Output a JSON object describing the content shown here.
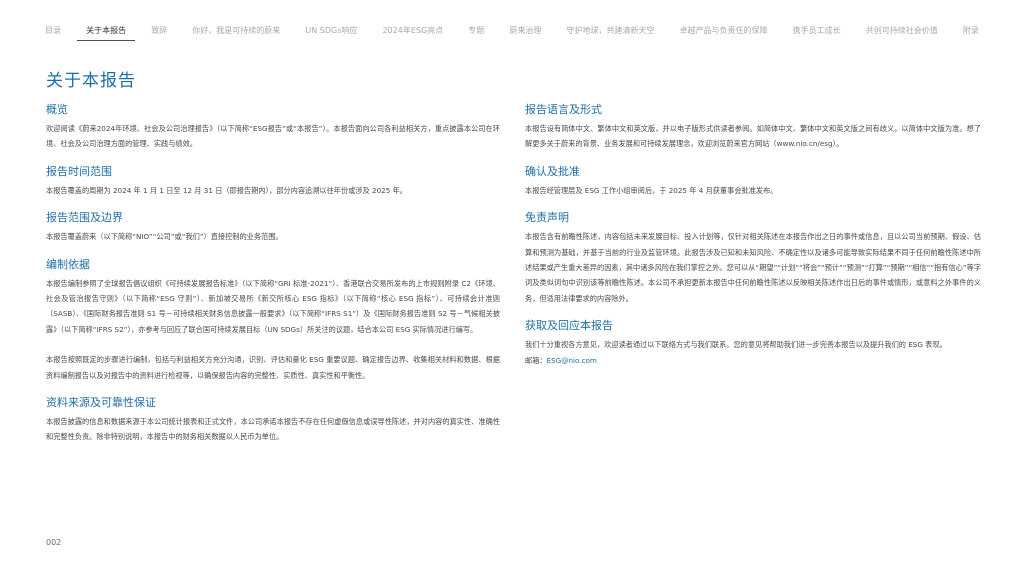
{
  "nav": {
    "items": [
      {
        "label": "目录"
      },
      {
        "label": "关于本报告"
      },
      {
        "label": "致辞"
      },
      {
        "label": "你好，我是可持续的蔚来"
      },
      {
        "label": "UN SDGs响应"
      },
      {
        "label": "2024年ESG亮点"
      },
      {
        "label": "专题"
      },
      {
        "label": "蔚来治理"
      },
      {
        "label": "守护地球，共建清新天空"
      },
      {
        "label": "卓越产品与负责任的保障"
      },
      {
        "label": "携手员工成长"
      },
      {
        "label": "共创可持续社会价值"
      },
      {
        "label": "附录"
      }
    ]
  },
  "page": {
    "title": "关于本报告",
    "number": "002"
  },
  "left": {
    "overview": {
      "heading": "概览",
      "text": "欢迎阅读《蔚来2024年环境、社会及公司治理报告》（以下简称“ESG报告”或“本报告”）。本报告面向公司各利益相关方，重点披露本公司在环境、社会及公司治理方面的管理、实践与绩效。"
    },
    "period": {
      "heading": "报告时间范围",
      "text": "本报告覆盖的周期为 2024 年 1 月 1 日至 12 月 31 日（即报告期内），部分内容追溯以往年份或涉及 2025 年。"
    },
    "scope": {
      "heading": "报告范围及边界",
      "text": "本报告覆盖蔚来（以下简称“NIO”“公司”或“我们”）直接控制的业务范围。"
    },
    "basis": {
      "heading": "编制依据",
      "text1": "本报告编制参照了全球报告倡议组织《可持续发展报告标准》（以下简称“GRI 标准-2021”）、香港联合交易所发布的上市规则附录 C2《环境、社会及管治报告守则》（以下简称“ESG 守则”）、新加坡交易所《新交所核心 ESG 指标》（以下简称“核心 ESG 指标”）、可持续会计准则（SASB）、《国际财务报告准则 S1 号－可持续相关财务信息披露一般要求》（以下简称“IFRS S1”）及《国际财务报告准则 S2 号－气候相关披露》（以下简称“IFRS S2”），亦参考与回应了联合国可持续发展目标（UN SDGs）所关注的议题，结合本公司 ESG 实际情况进行编写。",
      "text2": "本报告按照既定的步骤进行编制，包括与利益相关方充分沟通，识别、评估和量化 ESG 重要议题、确定报告边界、收集相关材料和数据、根据资料编制报告以及对报告中的资料进行检视等，以确保报告内容的完整性、实质性、真实性和平衡性。"
    },
    "data_source": {
      "heading": "资料来源及可靠性保证",
      "text": "本报告披露的信息和数据来源于本公司统计报表和正式文件，本公司承诺本报告不存在任何虚假信息或误导性陈述，并对内容的真实性、准确性和完整性负责。除非特别说明，本报告中的财务相关数据以人民币为单位。"
    }
  },
  "right": {
    "language": {
      "heading": "报告语言及形式",
      "text": "本报告设有简体中文、繁体中文和英文版，并以电子版形式供读者参阅。如简体中文、繁体中文和英文版之间有歧义，以简体中文版为准。想了解更多关于蔚来的背景、业务发展和可持续发展理念，欢迎浏览蔚来官方网站（www.nio.cn/esg）。"
    },
    "approval": {
      "heading": "确认及批准",
      "text": "本报告经管理层及 ESG 工作小组审阅后，于 2025 年 4 月获董事会批准发布。"
    },
    "disclaimer": {
      "heading": "免责声明",
      "text": "本报告含有前瞻性陈述，内容包括未来发展目标、投入计划等，仅针对相关陈述在本报告作出之日的事件或信息，且以公司当前预期、假设、估算和预测为基础，并基于当前的行业及监管环境。此报告涉及已知和未知风险、不确定性以及诸多可能导致实际结果不同于任何前瞻性陈述中所述结果或产生重大差异的因素，其中诸多风险在我们掌控之外。您可以从“期望”“计划”“将会”“预计”“预测”“打算”“预期”“相信”“抱有信心”等字词及类似词句中识别该等前瞻性陈述。本公司不承担更新本报告中任何前瞻性陈述以反映相关陈述作出日后的事件或情形，或意料之外事件的义务，但适用法律要求的内容除外。"
    },
    "feedback": {
      "heading": "获取及回应本报告",
      "text": "我们十分重视各方意见，欢迎读者通过以下联络方式与我们联系。您的意见将帮助我们进一步完善本报告以及提升我们的 ESG 表现。",
      "email_label": "邮箱：",
      "email": "ESG@nio.com"
    }
  }
}
